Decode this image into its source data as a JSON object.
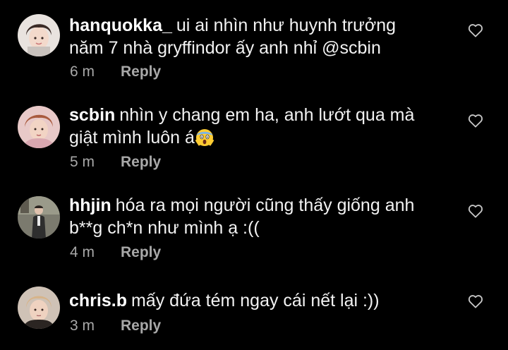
{
  "theme": {
    "background": "#000000",
    "text": "#f2f2f2",
    "muted": "#a8a8a8"
  },
  "comments": [
    {
      "username": "hanquokka_",
      "line1": "ui ai nhìn như huynh trưởng",
      "line2": "năm 7 nhà gryffindor ấy anh nhỉ @scbin",
      "time": "6 m",
      "reply": "Reply",
      "like_icon": "heart-outline-icon"
    },
    {
      "username": "scbin",
      "line1": "nhìn y chang em ha, anh lướt qua mà",
      "line2": "giật mình luôn á",
      "emoji": "face-screaming-in-fear-icon",
      "time": "5 m",
      "reply": "Reply",
      "like_icon": "heart-outline-icon"
    },
    {
      "username": "hhjin",
      "line1": "hóa ra mọi người cũng thấy giống anh",
      "line2": "b**g ch*n như mình ạ :((",
      "time": "4 m",
      "reply": "Reply",
      "like_icon": "heart-outline-icon"
    },
    {
      "username": "chris.b",
      "line1": "mấy đứa tém ngay cái nết lại :))",
      "time": "3 m",
      "reply": "Reply",
      "like_icon": "heart-outline-icon"
    }
  ]
}
